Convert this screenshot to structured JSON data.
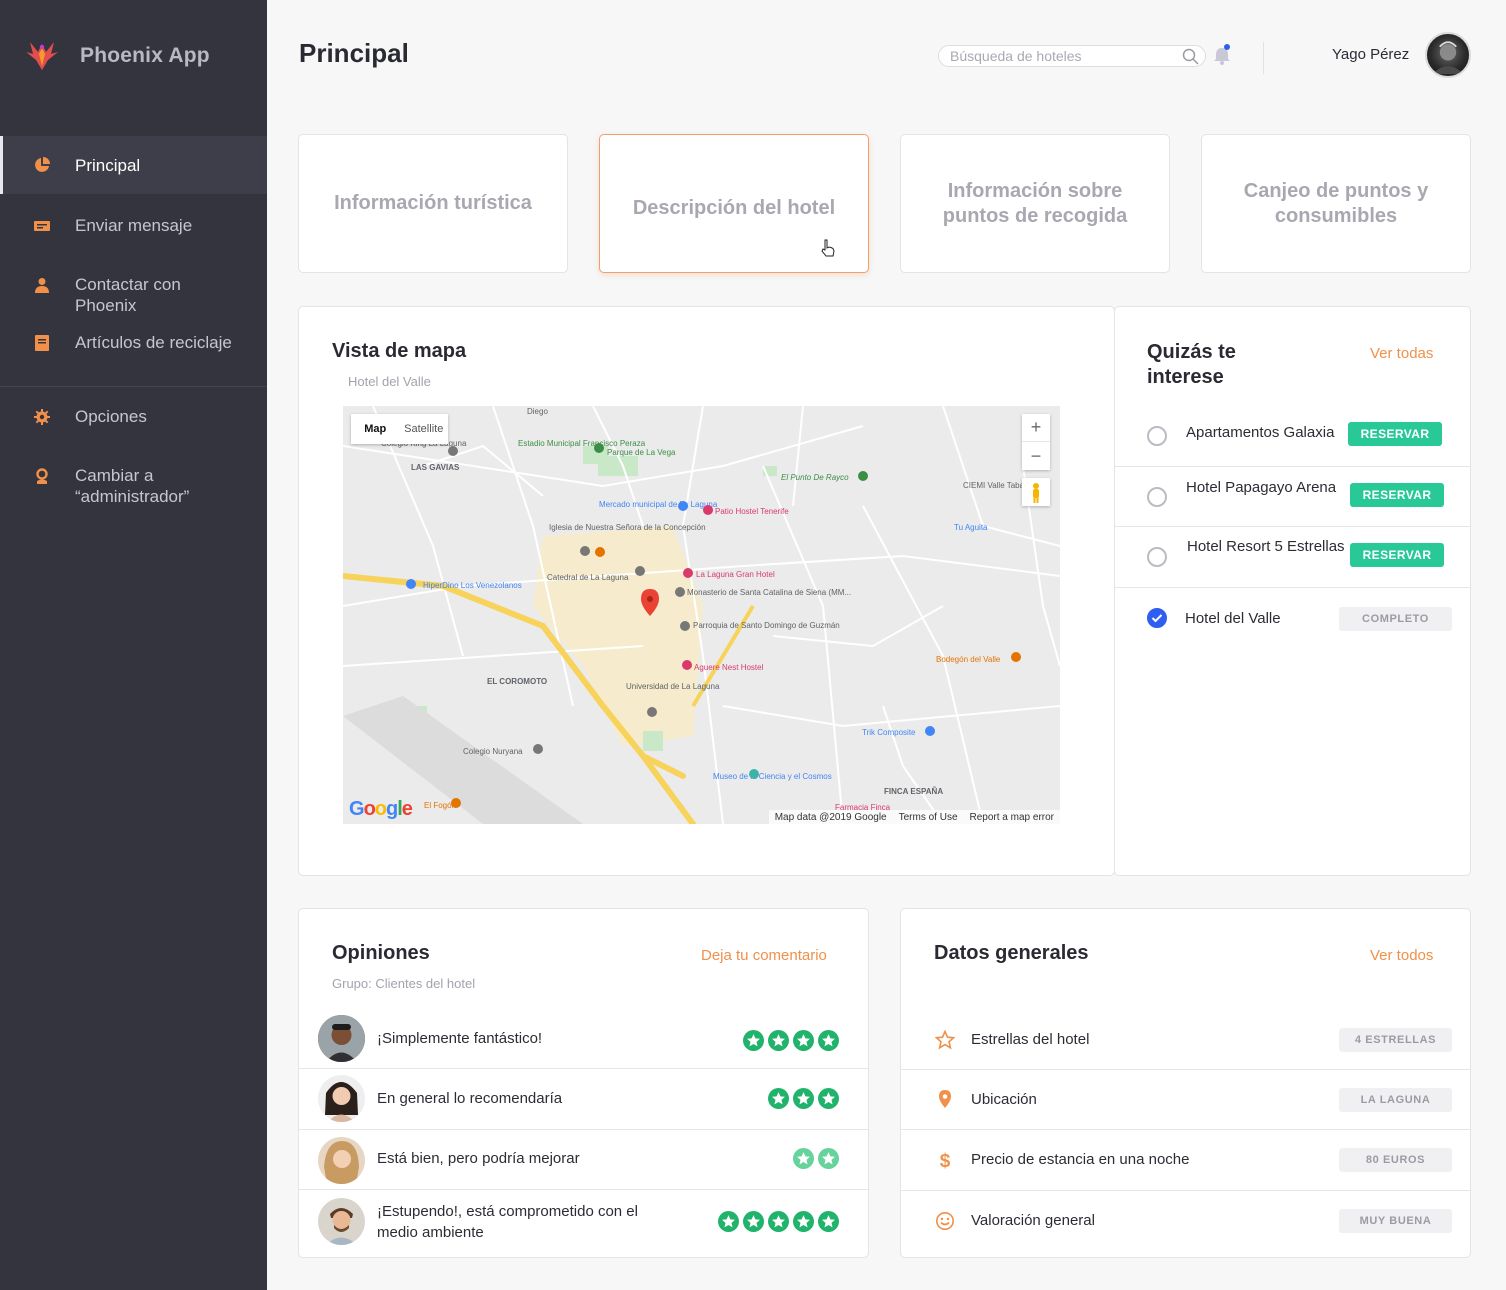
{
  "app": {
    "name": "Phoenix App"
  },
  "sidebar": {
    "items": [
      {
        "label": "Principal",
        "icon": "pie-chart-icon"
      },
      {
        "label": "Enviar mensaje",
        "icon": "message-icon"
      },
      {
        "label": "Contactar con Phoenix",
        "icon": "contact-icon"
      },
      {
        "label": "Artículos de reciclaje",
        "icon": "book-icon"
      },
      {
        "label": "Opciones",
        "icon": "gear-icon"
      },
      {
        "label": "Cambiar a “administrador”",
        "icon": "user-icon"
      }
    ],
    "active": "Principal",
    "icon_color": "#f0904a"
  },
  "header": {
    "title": "Principal",
    "search_placeholder": "Búsqueda de hoteles",
    "user_name": "Yago Pérez"
  },
  "tiles": [
    {
      "label": "Información turística"
    },
    {
      "label": "Descripción del hotel",
      "selected": true
    },
    {
      "label": "Información sobre puntos de recogida"
    },
    {
      "label": "Canjeo de puntos y consumibles"
    }
  ],
  "map_card": {
    "title": "Vista de mapa",
    "subtitle": "Hotel del Valle",
    "map_tab": "Map",
    "satellite_tab": "Satellite",
    "zoom_in": "+",
    "zoom_out": "−",
    "attribution": {
      "data": "Map data @2019 Google",
      "terms": "Terms of Use",
      "report": "Report a map error"
    },
    "logo": "Google",
    "labels": [
      "Diego",
      "Estadio Municipal Francisco Peraza",
      "Parque de La Vega",
      "Colegio King La Laguna",
      "LAS GAVIAS",
      "Mercado municipal de La Laguna",
      "Patio Hostel Tenerife",
      "El Punto De Rayco",
      "CIEMI Valle Tabares",
      "Iglesia de Nuestra Señora de la Concepción",
      "Tu Aguita",
      "Catedral de La Laguna",
      "La Laguna Gran Hotel",
      "HiperDino Los Venezolanos",
      "Monasterio de Santa Catalina de Siena (MM...",
      "Parroquia de Santo Domingo de Guzmán",
      "Aguere Nest Hostel",
      "Bodegón del Valle",
      "EL COROMOTO",
      "Universidad de La Laguna",
      "Colegio Nuryana",
      "Trik Composite",
      "Museo de la Ciencia y el Cosmos",
      "FINCA ESPAÑA",
      "El Fogón",
      "Farmacia Finca"
    ]
  },
  "suggestions": {
    "title": "Quizás te interese",
    "link": "Ver todas",
    "items": [
      {
        "name": "Apartamentos Galaxia",
        "action": "RESERVAR",
        "checked": false
      },
      {
        "name": "Hotel Papagayo Arena",
        "action": "RESERVAR",
        "checked": false
      },
      {
        "name": "Hotel Resort 5 Estrellas",
        "action": "RESERVAR",
        "checked": false
      },
      {
        "name": "Hotel del Valle",
        "action": "COMPLETO",
        "checked": true
      }
    ]
  },
  "opinions": {
    "title": "Opiniones",
    "subtitle": "Grupo: Clientes del hotel",
    "link": "Deja tu comentario",
    "items": [
      {
        "text": "¡Simplemente fantástico!",
        "stars": 4
      },
      {
        "text": "En general lo recomendaría",
        "stars": 3
      },
      {
        "text": "Está bien, pero podría mejorar",
        "stars": 2
      },
      {
        "text": "¡Estupendo!, está comprometido con el medio ambiente",
        "stars": 5
      }
    ]
  },
  "general": {
    "title": "Datos generales",
    "link": "Ver todos",
    "items": [
      {
        "label": "Estrellas del hotel",
        "value": "4 ESTRELLAS",
        "icon": "star-icon"
      },
      {
        "label": "Ubicación",
        "value": "LA LAGUNA",
        "icon": "location-pin-icon"
      },
      {
        "label": "Precio de estancia en una noche",
        "value": "80 EUROS",
        "icon": "dollar-icon"
      },
      {
        "label": "Valoración general",
        "value": "MUY BUENA",
        "icon": "smiley-icon"
      }
    ]
  },
  "colors": {
    "accent": "#f0904a",
    "success": "#28c996",
    "star": "#21b36b",
    "radio_checked": "#2f5ff0",
    "sidebar": "#34343f"
  }
}
